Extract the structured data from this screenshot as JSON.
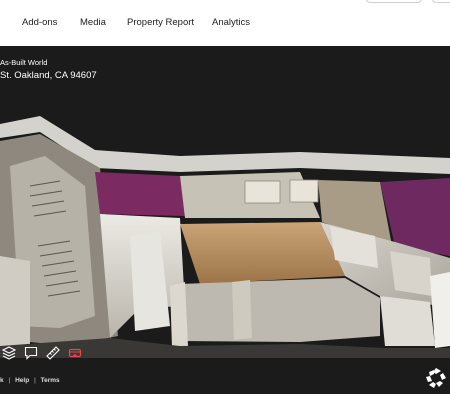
{
  "header": {
    "tabs": [
      {
        "label": "Add-ons"
      },
      {
        "label": "Media"
      },
      {
        "label": "Property Report"
      },
      {
        "label": "Analytics"
      }
    ]
  },
  "viewer": {
    "title": "As-Built World",
    "address": "St. Oakland, CA 94607",
    "footer": {
      "link_partial": "k",
      "help": "Help",
      "terms": "Terms",
      "separator": "|"
    },
    "toolbar": [
      {
        "icon": "layers-icon"
      },
      {
        "icon": "comment-icon"
      },
      {
        "icon": "ruler-icon"
      },
      {
        "icon": "vr-headset-icon",
        "color": "#e5484d"
      }
    ],
    "brand_icon": "matterport-logo-icon"
  },
  "colors": {
    "viewer_bg": "#1b1b1b",
    "accent_red": "#e5484d",
    "wall_magenta": "#8a2a6a",
    "floor_wood": "#b08a5a"
  }
}
